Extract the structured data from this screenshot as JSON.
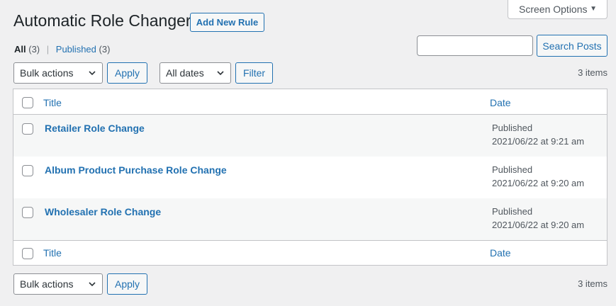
{
  "header": {
    "title": "Automatic Role Changer",
    "add_new": "Add New Rule"
  },
  "screen_options": {
    "label": "Screen Options"
  },
  "views": {
    "all_label": "All",
    "all_count": "(3)",
    "separator": "|",
    "published_label": "Published",
    "published_count": "(3)"
  },
  "search": {
    "value": "",
    "button": "Search Posts"
  },
  "top_actions": {
    "bulk": "Bulk actions",
    "apply": "Apply",
    "dates": "All dates",
    "filter": "Filter",
    "items": "3 items"
  },
  "bottom_actions": {
    "bulk": "Bulk actions",
    "apply": "Apply",
    "items": "3 items"
  },
  "table": {
    "columns": {
      "title": "Title",
      "date": "Date"
    },
    "rows": [
      {
        "title": "Retailer Role Change",
        "status": "Published",
        "date": "2021/06/22 at 9:21 am"
      },
      {
        "title": "Album Product Purchase Role Change",
        "status": "Published",
        "date": "2021/06/22 at 9:20 am"
      },
      {
        "title": "Wholesaler Role Change",
        "status": "Published",
        "date": "2021/06/22 at 9:20 am"
      }
    ]
  },
  "colors": {
    "link": "#2271b1",
    "background": "#f0f0f1",
    "border": "#c3c4c7"
  }
}
